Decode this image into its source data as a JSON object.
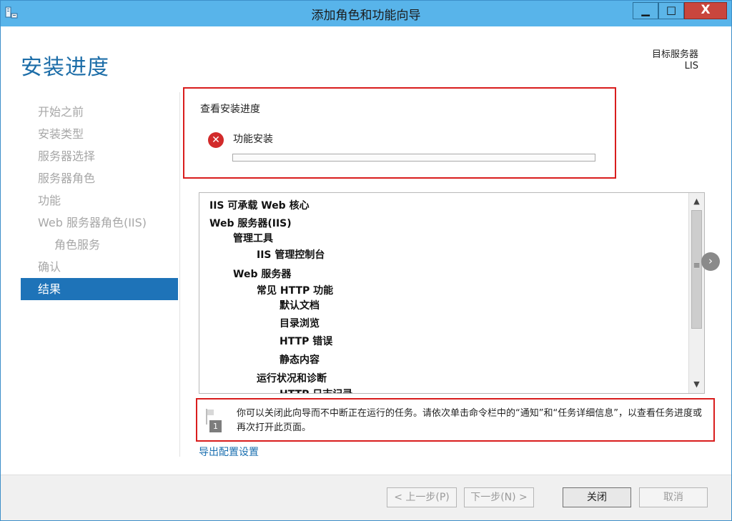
{
  "window": {
    "title": "添加角色和功能向导",
    "min_glyph": "▁",
    "max_glyph": "□",
    "close_glyph": "X"
  },
  "header": {
    "page_title": "安装进度",
    "target_label": "目标服务器",
    "target_server": "LIS"
  },
  "nav": {
    "items": [
      {
        "label": "开始之前",
        "active": false
      },
      {
        "label": "安装类型",
        "active": false
      },
      {
        "label": "服务器选择",
        "active": false
      },
      {
        "label": "服务器角色",
        "active": false
      },
      {
        "label": "功能",
        "active": false
      },
      {
        "label": "Web 服务器角色(IIS)",
        "active": false
      },
      {
        "label": "角色服务",
        "active": false,
        "sub": true
      },
      {
        "label": "确认",
        "active": false
      },
      {
        "label": "结果",
        "active": true
      }
    ]
  },
  "progress": {
    "title": "查看安装进度",
    "status_icon": "error-icon",
    "status_glyph": "✕",
    "feature_label": "功能安装",
    "value": 0
  },
  "features_list": [
    {
      "label": "IIS 可承载 Web 核心",
      "level": 0
    },
    {
      "label": "Web 服务器(IIS)",
      "level": 0
    },
    {
      "label": "管理工具",
      "level": 1
    },
    {
      "label": "IIS 管理控制台",
      "level": 2
    },
    {
      "label": "Web 服务器",
      "level": 1
    },
    {
      "label": "常见 HTTP 功能",
      "level": 2
    },
    {
      "label": "默认文档",
      "level": 3
    },
    {
      "label": "目录浏览",
      "level": 3
    },
    {
      "label": "HTTP 错误",
      "level": 3
    },
    {
      "label": "静态内容",
      "level": 3
    },
    {
      "label": "运行状况和诊断",
      "level": 2
    },
    {
      "label": "HTTP 日志记录",
      "level": 3
    }
  ],
  "scrollbar": {
    "up": "▲",
    "down": "▼",
    "grip": "≡",
    "side_arrow": "›"
  },
  "notification": {
    "badge": "1",
    "text": "你可以关闭此向导而不中断正在运行的任务。请依次单击命令栏中的“通知”和“任务详细信息”，以查看任务进度或再次打开此页面。"
  },
  "export_link": "导出配置设置",
  "buttons": {
    "prev": "< 上一步(P)",
    "next": "下一步(N) >",
    "close": "关闭",
    "cancel": "取消"
  },
  "colors": {
    "title_bar": "#58b4ea",
    "accent": "#1e73b8",
    "highlight_border": "#d91d1d",
    "error": "#d22a2a"
  }
}
